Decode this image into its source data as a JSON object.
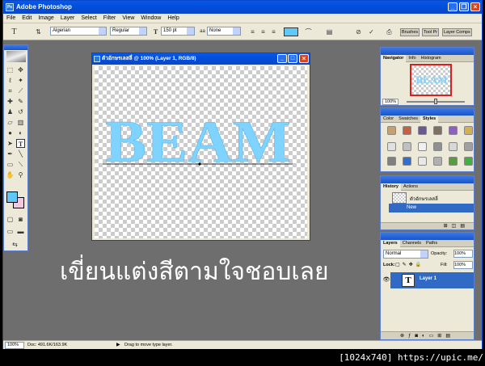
{
  "app": {
    "title": "Adobe Photoshop"
  },
  "menu": [
    "File",
    "Edit",
    "Image",
    "Layer",
    "Select",
    "Filter",
    "View",
    "Window",
    "Help"
  ],
  "options": {
    "font_family": "Algerian",
    "font_style": "Regular",
    "font_size": "150 pt",
    "antialias": "None"
  },
  "well_tabs": [
    "Brushes",
    "Tool Pr",
    "Layer Comps"
  ],
  "document": {
    "title": "ตัวอักษรเลสลี่ @ 100% (Layer 1, RGB/8)",
    "text": "BEAM"
  },
  "overlay_caption": "เขี่ยนแต่งสีตามใจชอบเลย",
  "navigator": {
    "tabs": [
      "Navigator",
      "Info",
      "Histogram"
    ],
    "zoom": "100%",
    "thumb_text": "BEAM"
  },
  "color_panel": {
    "tabs": [
      "Color",
      "Swatches",
      "Styles"
    ]
  },
  "history": {
    "tabs": [
      "History",
      "Actions"
    ],
    "snapshot": "ตัวอักษรเลสลี่",
    "state": "New"
  },
  "layers": {
    "tabs": [
      "Layers",
      "Channels",
      "Paths"
    ],
    "blend": "Normal",
    "opacity_label": "Opacity:",
    "opacity": "100%",
    "lock_label": "Lock:",
    "fill_label": "Fill:",
    "fill": "100%",
    "layer_name": "Layer 1"
  },
  "status": {
    "zoom": "100%",
    "doc": "Doc: 491.6K/163.9K",
    "hint": "Drag to move type layer."
  },
  "watermark": "[1024x740] https://upic.me/",
  "colors": {
    "foreground": "#5ec8f8",
    "background": "#f4c8e0",
    "text": "#7fd3ff"
  }
}
